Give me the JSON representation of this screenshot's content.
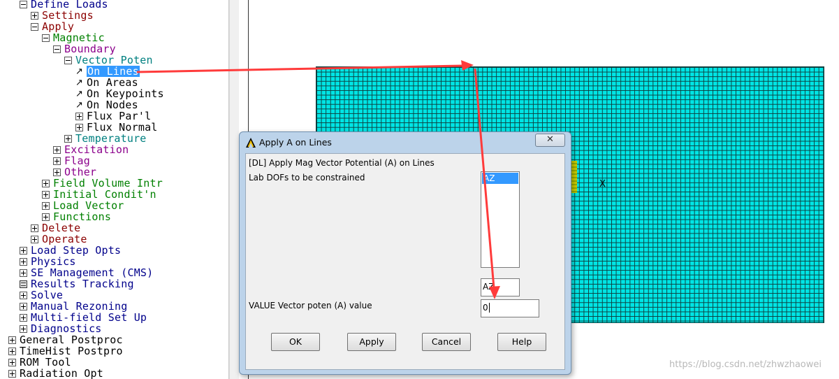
{
  "tree": {
    "items": [
      {
        "label": "Define Loads",
        "indent": 1,
        "icon": "minus",
        "color": "navy"
      },
      {
        "label": "Settings",
        "indent": 2,
        "icon": "plus",
        "color": "darkred"
      },
      {
        "label": "Apply",
        "indent": 2,
        "icon": "minus",
        "color": "darkred"
      },
      {
        "label": "Magnetic",
        "indent": 3,
        "icon": "minus",
        "color": "green"
      },
      {
        "label": "Boundary",
        "indent": 4,
        "icon": "minus",
        "color": "purple"
      },
      {
        "label": "Vector Poten",
        "indent": 5,
        "icon": "minus",
        "color": "teal"
      },
      {
        "label": "On Lines",
        "indent": 6,
        "icon": "arrow",
        "color": "black",
        "selected": true
      },
      {
        "label": "On Areas",
        "indent": 6,
        "icon": "arrow",
        "color": "black"
      },
      {
        "label": "On Keypoints",
        "indent": 6,
        "icon": "arrow",
        "color": "black"
      },
      {
        "label": "On Nodes",
        "indent": 6,
        "icon": "arrow",
        "color": "black"
      },
      {
        "label": "Flux Par'l",
        "indent": 6,
        "icon": "plus",
        "color": "black"
      },
      {
        "label": "Flux Normal",
        "indent": 6,
        "icon": "plus",
        "color": "black"
      },
      {
        "label": "Temperature",
        "indent": 5,
        "icon": "plus",
        "color": "teal"
      },
      {
        "label": "Excitation",
        "indent": 4,
        "icon": "plus",
        "color": "purple"
      },
      {
        "label": "Flag",
        "indent": 4,
        "icon": "plus",
        "color": "purple"
      },
      {
        "label": "Other",
        "indent": 4,
        "icon": "plus",
        "color": "purple"
      },
      {
        "label": "Field Volume Intr",
        "indent": 3,
        "icon": "plus",
        "color": "green"
      },
      {
        "label": "Initial Condit'n",
        "indent": 3,
        "icon": "plus",
        "color": "green"
      },
      {
        "label": "Load Vector",
        "indent": 3,
        "icon": "plus",
        "color": "green"
      },
      {
        "label": "Functions",
        "indent": 3,
        "icon": "plus",
        "color": "green"
      },
      {
        "label": "Delete",
        "indent": 2,
        "icon": "plus",
        "color": "darkred"
      },
      {
        "label": "Operate",
        "indent": 2,
        "icon": "plus",
        "color": "darkred"
      },
      {
        "label": "Load Step Opts",
        "indent": 1,
        "icon": "plus",
        "color": "navy"
      },
      {
        "label": "Physics",
        "indent": 1,
        "icon": "plus",
        "color": "navy"
      },
      {
        "label": "SE Management (CMS)",
        "indent": 1,
        "icon": "plus",
        "color": "navy"
      },
      {
        "label": "Results Tracking",
        "indent": 1,
        "icon": "calc",
        "color": "navy"
      },
      {
        "label": "Solve",
        "indent": 1,
        "icon": "plus",
        "color": "navy"
      },
      {
        "label": "Manual Rezoning",
        "indent": 1,
        "icon": "plus",
        "color": "navy"
      },
      {
        "label": "Multi-field Set Up",
        "indent": 1,
        "icon": "plus",
        "color": "navy"
      },
      {
        "label": "Diagnostics",
        "indent": 1,
        "icon": "plus",
        "color": "navy"
      },
      {
        "label": "General Postproc",
        "indent": 0,
        "icon": "plus",
        "color": "black"
      },
      {
        "label": "TimeHist Postpro",
        "indent": 0,
        "icon": "plus",
        "color": "black"
      },
      {
        "label": "ROM Tool",
        "indent": 0,
        "icon": "plus",
        "color": "black"
      },
      {
        "label": "Radiation Opt",
        "indent": 0,
        "icon": "plus",
        "color": "black"
      }
    ]
  },
  "graphics": {
    "axis_label": "X",
    "mesh_color": "#00e5e5",
    "watermark": "https://blog.csdn.net/zhwzhaowei"
  },
  "dialog": {
    "title": "Apply A on Lines",
    "close_glyph": "✕",
    "heading": "[DL]  Apply Mag Vector Potential (A) on Lines",
    "lab_label": "Lab    DOFs to be constrained",
    "lab_options": [
      "AZ"
    ],
    "lab_selected_text": "AZ",
    "value_label": "VALUE   Vector poten (A) value",
    "value_input": "0",
    "buttons": {
      "ok": "OK",
      "apply": "Apply",
      "cancel": "Cancel",
      "help": "Help"
    }
  },
  "annotation": {
    "color": "#ff3b3b"
  }
}
